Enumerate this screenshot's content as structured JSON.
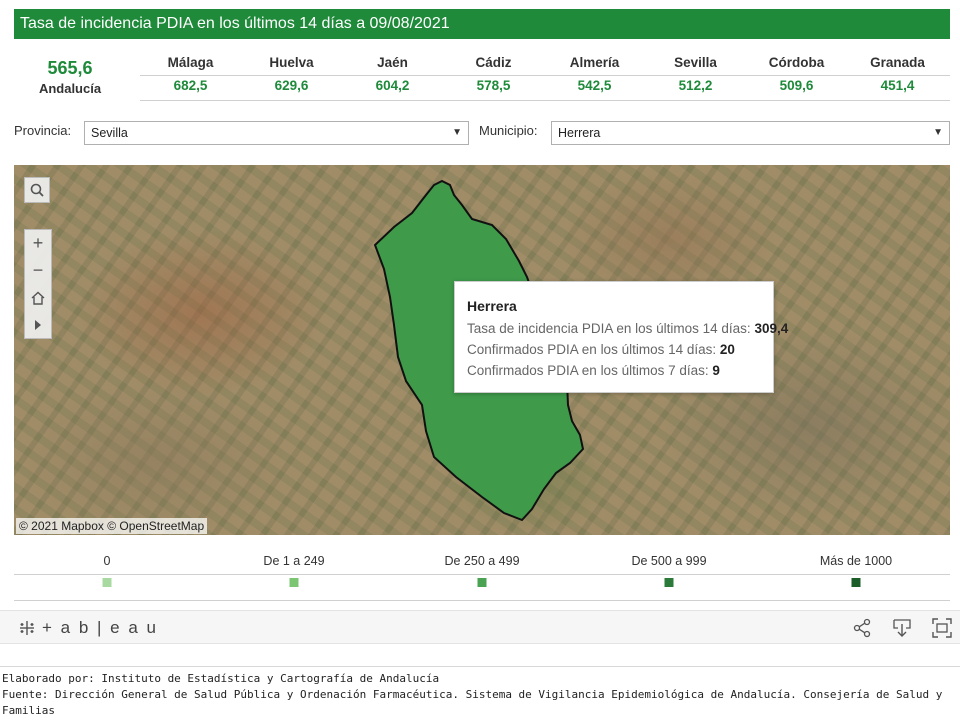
{
  "header": {
    "title": "Tasa de incidencia PDIA en los últimos 14 días a 09/08/2021"
  },
  "summary": {
    "total_value": "565,6",
    "total_label": "Andalucía",
    "provinces": [
      {
        "name": "Málaga",
        "value": "682,5"
      },
      {
        "name": "Huelva",
        "value": "629,6"
      },
      {
        "name": "Jaén",
        "value": "604,2"
      },
      {
        "name": "Cádiz",
        "value": "578,5"
      },
      {
        "name": "Almería",
        "value": "542,5"
      },
      {
        "name": "Sevilla",
        "value": "512,2"
      },
      {
        "name": "Córdoba",
        "value": "509,6"
      },
      {
        "name": "Granada",
        "value": "451,4"
      }
    ]
  },
  "filters": {
    "provincia_label": "Provincia:",
    "provincia_value": "Sevilla",
    "municipio_label": "Municipio:",
    "municipio_value": "Herrera"
  },
  "map": {
    "attribution": "© 2021 Mapbox © OpenStreetMap",
    "region_color": "#3f9a4a",
    "tools": {
      "search": "search-icon",
      "zoom_in": "+",
      "zoom_out": "−",
      "home": "home-icon",
      "expand": "play-icon"
    }
  },
  "tooltip": {
    "name": "Herrera",
    "rows": [
      {
        "label": "Tasa de incidencia PDIA en los últimos 14 días:",
        "value": "309,4"
      },
      {
        "label": "Confirmados PDIA en los últimos 14 días:",
        "value": "20"
      },
      {
        "label": "Confirmados PDIA en los últimos 7 días:",
        "value": "9"
      }
    ]
  },
  "legend": [
    {
      "label": "0",
      "color": "#a8d9a0"
    },
    {
      "label": "De 1 a 249",
      "color": "#7cc573"
    },
    {
      "label": "De 250 a 499",
      "color": "#4aa352"
    },
    {
      "label": "De 500 a 999",
      "color": "#2b7a3a"
    },
    {
      "label": "Más de 1000",
      "color": "#1b5e2a"
    }
  ],
  "toolbar": {
    "logo": "+ a b | e a u",
    "icons": [
      "share-icon",
      "download-icon",
      "fullscreen-icon"
    ]
  },
  "footer": {
    "line1": "Elaborado por: Instituto de Estadística y Cartografía de Andalucía",
    "line2": "Fuente: Dirección General de Salud Pública y Ordenación Farmacéutica. Sistema de Vigilancia Epidemiológica de Andalucía. Consejería de Salud y Familias"
  }
}
